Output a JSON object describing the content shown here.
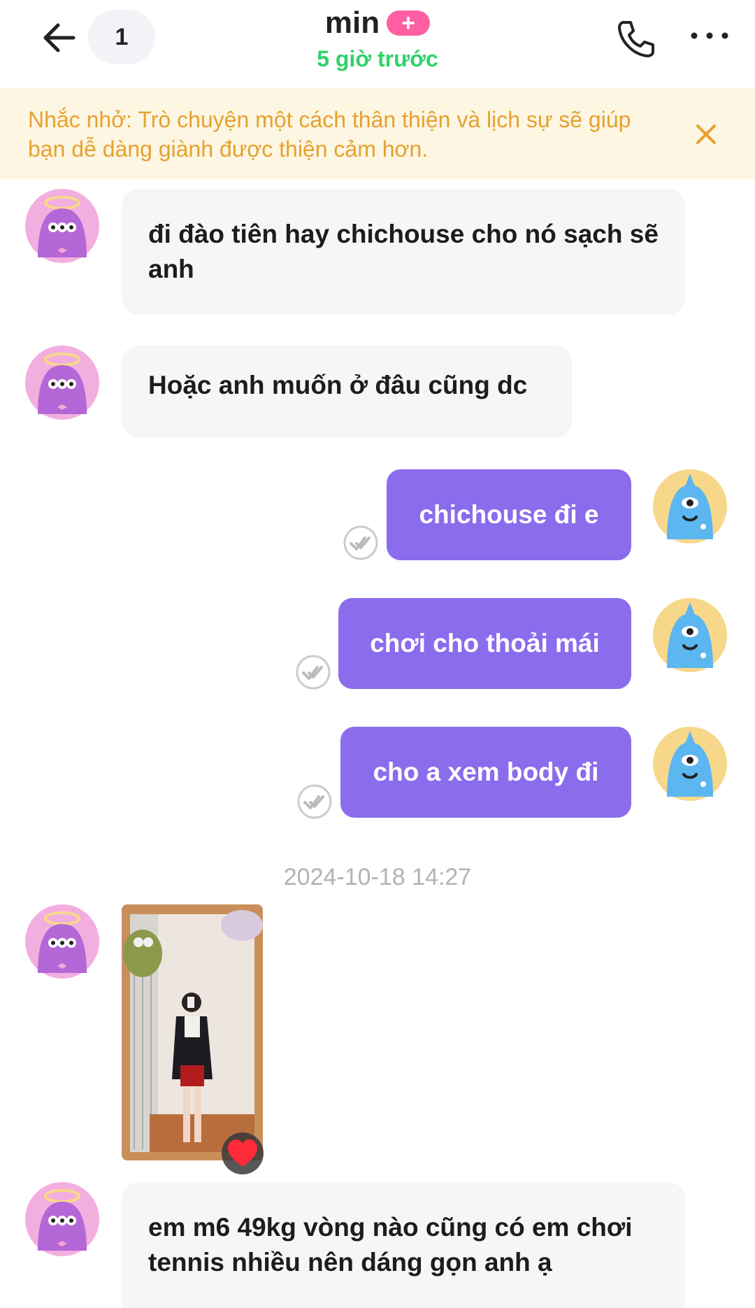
{
  "header": {
    "unread_count": "1",
    "contact_name": "min",
    "plus_badge": "+",
    "last_seen": "5 giờ trước",
    "status_color": "#2ed36a"
  },
  "notice": {
    "text": "Nhắc nhở: Trò chuyện một cách thân thiện và lịch sự sẽ giúp bạn dễ dàng giành được thiện cảm hơn.",
    "color": "#e6a12e"
  },
  "messages": [
    {
      "sender": "them",
      "text": "đi đào tiên hay chichouse cho nó sạch sẽ anh"
    },
    {
      "sender": "them",
      "text": "Hoặc anh muốn ở đâu cũng dc"
    },
    {
      "sender": "me",
      "text": "chichouse đi e",
      "status": "read"
    },
    {
      "sender": "me",
      "text": "chơi cho thoải mái",
      "status": "read"
    },
    {
      "sender": "me",
      "text": "cho a xem body đi",
      "status": "read"
    },
    {
      "sender": "them",
      "type": "photo",
      "reaction": "heart"
    },
    {
      "sender": "them",
      "text": "em m6 49kg vòng nào cũng có em chơi tennis nhiều nên dáng gọn anh ạ"
    }
  ],
  "timestamp": "2024-10-18 14:27",
  "colors": {
    "outgoing_bubble": "#8a6cec",
    "incoming_bubble": "#f5f6f8",
    "accent_pink": "#ff5fa2"
  }
}
